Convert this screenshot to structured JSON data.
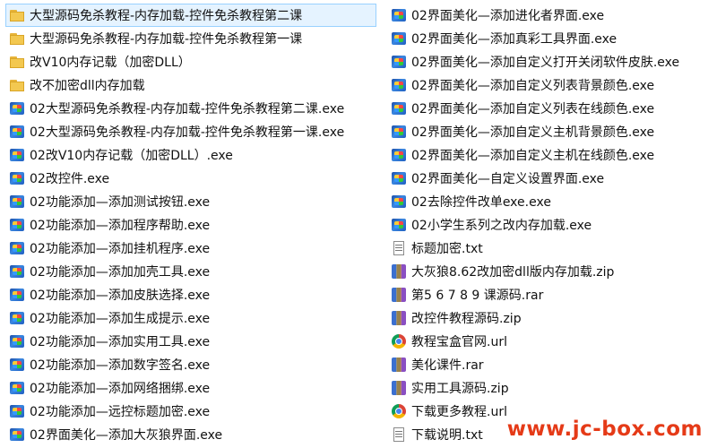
{
  "left_column": [
    {
      "name": "大型源码免杀教程-内存加载-控件免杀教程第二课",
      "icon": "folder-icon",
      "selected": true
    },
    {
      "name": "大型源码免杀教程-内存加载-控件免杀教程第一课",
      "icon": "folder-icon"
    },
    {
      "name": "改V10内存记载（加密DLL）",
      "icon": "folder-icon"
    },
    {
      "name": "改不加密dll内存加载",
      "icon": "folder-icon"
    },
    {
      "name": "02大型源码免杀教程-内存加载-控件免杀教程第二课.exe",
      "icon": "exe-icon"
    },
    {
      "name": "02大型源码免杀教程-内存加载-控件免杀教程第一课.exe",
      "icon": "exe-icon"
    },
    {
      "name": "02改V10内存记载（加密DLL）.exe",
      "icon": "exe-icon"
    },
    {
      "name": "02改控件.exe",
      "icon": "exe-icon"
    },
    {
      "name": "02功能添加—添加测试按钮.exe",
      "icon": "exe-icon"
    },
    {
      "name": "02功能添加—添加程序帮助.exe",
      "icon": "exe-icon"
    },
    {
      "name": "02功能添加—添加挂机程序.exe",
      "icon": "exe-icon"
    },
    {
      "name": "02功能添加—添加加壳工具.exe",
      "icon": "exe-icon"
    },
    {
      "name": "02功能添加—添加皮肤选择.exe",
      "icon": "exe-icon"
    },
    {
      "name": "02功能添加—添加生成提示.exe",
      "icon": "exe-icon"
    },
    {
      "name": "02功能添加—添加实用工具.exe",
      "icon": "exe-icon"
    },
    {
      "name": "02功能添加—添加数字签名.exe",
      "icon": "exe-icon"
    },
    {
      "name": "02功能添加—添加网络捆绑.exe",
      "icon": "exe-icon"
    },
    {
      "name": "02功能添加—远控标题加密.exe",
      "icon": "exe-icon"
    },
    {
      "name": "02界面美化—添加大灰狼界面.exe",
      "icon": "exe-icon"
    }
  ],
  "right_column": [
    {
      "name": "02界面美化—添加进化者界面.exe",
      "icon": "exe-icon"
    },
    {
      "name": "02界面美化—添加真彩工具界面.exe",
      "icon": "exe-icon"
    },
    {
      "name": "02界面美化—添加自定义打开关闭软件皮肤.exe",
      "icon": "exe-icon"
    },
    {
      "name": "02界面美化—添加自定义列表背景颜色.exe",
      "icon": "exe-icon"
    },
    {
      "name": "02界面美化—添加自定义列表在线颜色.exe",
      "icon": "exe-icon"
    },
    {
      "name": "02界面美化—添加自定义主机背景颜色.exe",
      "icon": "exe-icon"
    },
    {
      "name": "02界面美化—添加自定义主机在线颜色.exe",
      "icon": "exe-icon"
    },
    {
      "name": "02界面美化—自定义设置界面.exe",
      "icon": "exe-icon"
    },
    {
      "name": "02去除控件改单exe.exe",
      "icon": "exe-icon"
    },
    {
      "name": "02小学生系列之改内存加载.exe",
      "icon": "exe-icon"
    },
    {
      "name": "标题加密.txt",
      "icon": "txt-icon"
    },
    {
      "name": "大灰狼8.62改加密dll版内存加载.zip",
      "icon": "archive-icon"
    },
    {
      "name": "第5 6 7 8 9 课源码.rar",
      "icon": "archive-icon"
    },
    {
      "name": "改控件教程源码.zip",
      "icon": "archive-icon"
    },
    {
      "name": "教程宝盒官网.url",
      "icon": "url-icon"
    },
    {
      "name": "美化课件.rar",
      "icon": "archive-icon"
    },
    {
      "name": "实用工具源码.zip",
      "icon": "archive-icon"
    },
    {
      "name": "下载更多教程.url",
      "icon": "url-icon"
    },
    {
      "name": "下载说明.txt",
      "icon": "txt-icon"
    }
  ],
  "watermark": "www.jc-box.com",
  "colors": {
    "selection_bg": "#e5f3ff",
    "selection_border": "#99d1ff",
    "watermark": "#e53a17"
  }
}
